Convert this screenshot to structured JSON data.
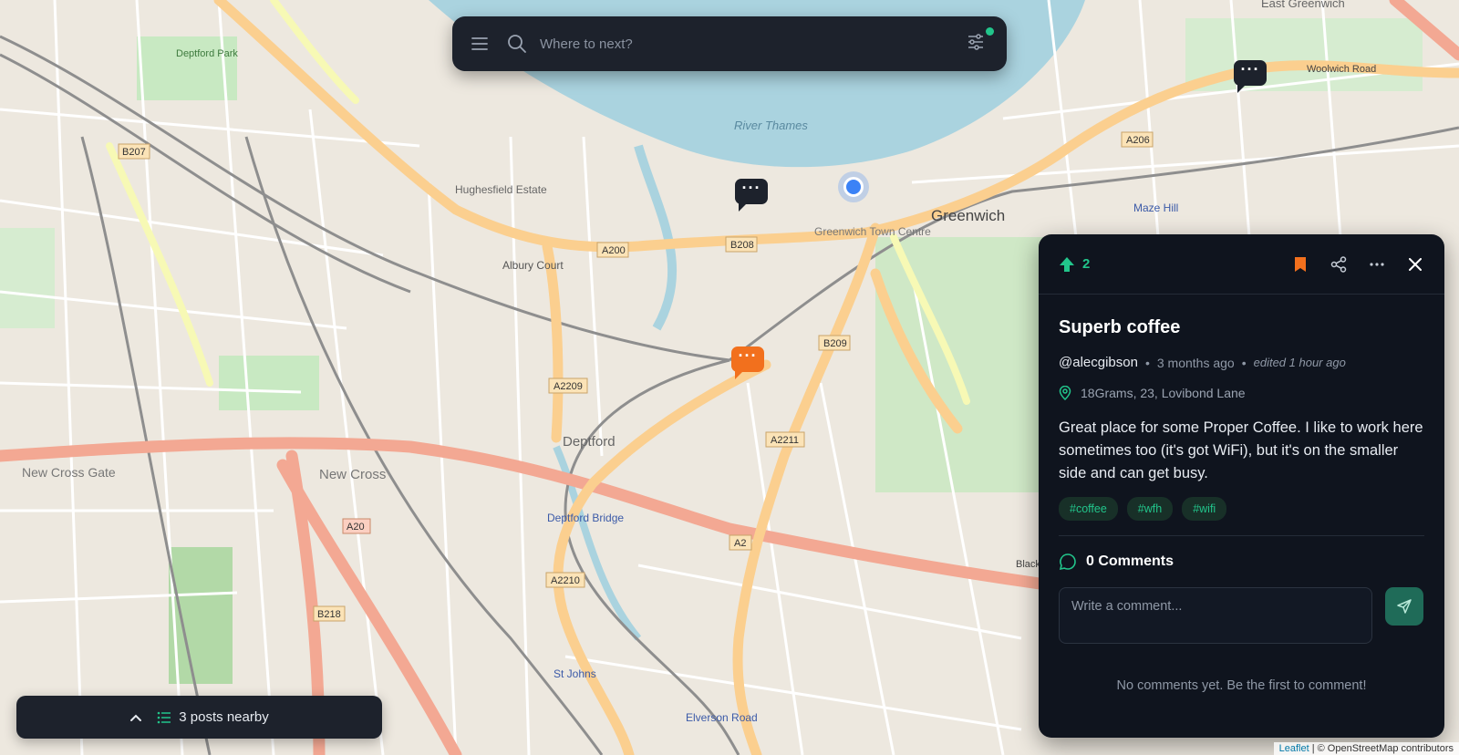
{
  "search": {
    "placeholder": "Where to next?"
  },
  "map_labels": {
    "greenwich": "Greenwich",
    "deptford": "Deptford",
    "new_cross": "New Cross",
    "new_cross_gate": "New Cross Gate",
    "river_thames": "River Thames",
    "east_greenwich": "East Greenwich",
    "maze_hill": "Maze Hill",
    "blackheath_hill": "Blackheath Hill",
    "deptford_bridge": "Deptford Bridge",
    "greenwich_town_centre": "Greenwich Town Centre",
    "hughesfield_estate": "Hughesfield Estate",
    "albury_court": "Albury Court",
    "woolwich_road": "Woolwich Road",
    "deptford_park": "Deptford Park",
    "elverson_road": "Elverson Road",
    "st_johns": "St Johns",
    "a200": "A200",
    "a206": "A206",
    "b208": "B208",
    "b209": "B209",
    "a2209": "A2209",
    "a2211": "A2211",
    "a2210": "A2210",
    "a2": "A2",
    "a20": "A20",
    "b218": "B218",
    "b207": "B207"
  },
  "nearby": {
    "label": "3 posts nearby"
  },
  "post": {
    "votes": "2",
    "title": "Superb coffee",
    "author": "@alecgibson",
    "posted": "3 months ago",
    "edited": "edited 1 hour ago",
    "location": "18Grams, 23, Lovibond Lane",
    "body": "Great place for some Proper Coffee. I like to work here sometimes too (it's got WiFi), but it's on the smaller side and can get busy.",
    "tags": [
      "#coffee",
      "#wfh",
      "#wifi"
    ],
    "comments_title": "0 Comments",
    "comment_placeholder": "Write a comment...",
    "no_comments": "No comments yet. Be the first to comment!"
  },
  "attribution": {
    "leaflet": "Leaflet",
    "osm": "| © OpenStreetMap contributors"
  },
  "colors": {
    "accent": "#22c58b",
    "active_marker": "#f2701d",
    "panel_bg": "#0f141e",
    "bar_bg": "#1d222c"
  }
}
